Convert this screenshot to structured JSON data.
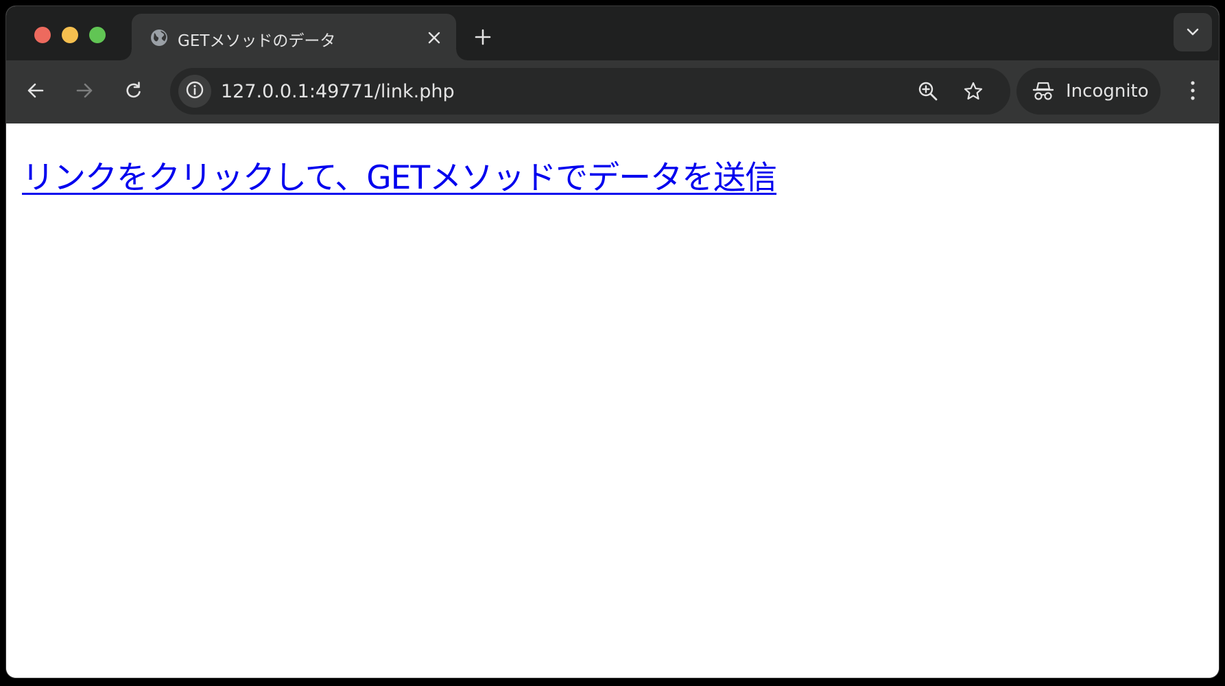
{
  "window": {
    "controls": [
      "close",
      "minimize",
      "maximize"
    ]
  },
  "tab": {
    "title": "GETメソッドのデータ",
    "favicon": "globe-icon",
    "close_icon": "close-icon"
  },
  "tabstrip": {
    "new_tab_icon": "plus-icon",
    "tab_search_icon": "chevron-down-icon"
  },
  "toolbar": {
    "back_icon": "arrow-left-icon",
    "forward_icon": "arrow-right-icon",
    "reload_icon": "reload-icon",
    "site_info_icon": "info-icon",
    "url": "127.0.0.1:49771/link.php",
    "zoom_icon": "zoom-in-icon",
    "bookmark_icon": "star-icon",
    "incognito_label": "Incognito",
    "menu_icon": "more-vert-icon"
  },
  "page": {
    "link_text": "リンクをクリックして、GETメソッドでデータを送信"
  },
  "colors": {
    "tabstrip_bg": "#1f2020",
    "toolbar_bg": "#353636",
    "omnibox_bg": "#272828",
    "link": "#0000ee",
    "close": "#ed6a5e",
    "minimize": "#f5bf4f",
    "maximize": "#61c554"
  }
}
